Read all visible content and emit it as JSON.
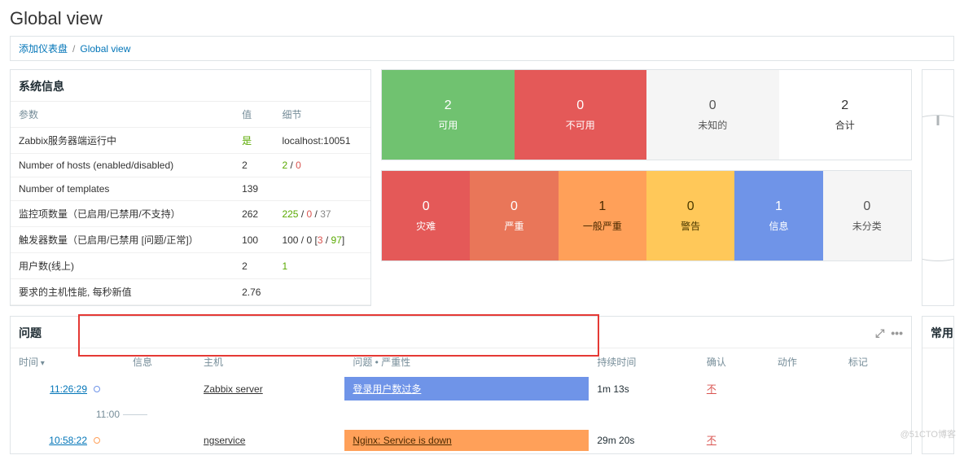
{
  "page": {
    "title": "Global view"
  },
  "breadcrumb": {
    "add": "添加仪表盘",
    "current": "Global view"
  },
  "sysinfo": {
    "title": "系统信息",
    "cols": {
      "param": "参数",
      "value": "值",
      "detail": "细节"
    },
    "rows": [
      {
        "param": "Zabbix服务器端运行中",
        "value_html": "yes",
        "value": "是",
        "detail": "localhost:10051"
      },
      {
        "param": "Number of hosts (enabled/disabled)",
        "value": "2",
        "detail_parts": [
          "2",
          " / ",
          "0"
        ],
        "detail_classes": [
          "green",
          "",
          "red"
        ]
      },
      {
        "param": "Number of templates",
        "value": "139",
        "detail": ""
      },
      {
        "param": "监控项数量（已启用/已禁用/不支持）",
        "value": "262",
        "detail_parts": [
          "225",
          " / ",
          "0",
          " / ",
          "37"
        ],
        "detail_classes": [
          "green",
          "",
          "red",
          "",
          "grey"
        ]
      },
      {
        "param": "触发器数量（已启用/已禁用 [问题/正常]）",
        "value": "100",
        "detail_parts": [
          "100 / 0 [",
          "3",
          " / ",
          "97",
          "]"
        ],
        "detail_classes": [
          "",
          "red",
          "",
          "green",
          ""
        ]
      },
      {
        "param": "用户数(线上)",
        "value": "2",
        "detail_parts": [
          "1"
        ],
        "detail_classes": [
          "green"
        ]
      },
      {
        "param": "要求的主机性能, 每秒新值",
        "value": "2.76",
        "detail": ""
      }
    ]
  },
  "hosts_status": [
    {
      "num": "2",
      "label": "可用",
      "cls": "c-avail"
    },
    {
      "num": "0",
      "label": "不可用",
      "cls": "c-unavail"
    },
    {
      "num": "0",
      "label": "未知的",
      "cls": "c-unknown"
    },
    {
      "num": "2",
      "label": "合计",
      "cls": "c-total"
    }
  ],
  "severity_status": [
    {
      "num": "0",
      "label": "灾难",
      "cls": "c-disaster"
    },
    {
      "num": "0",
      "label": "严重",
      "cls": "c-high"
    },
    {
      "num": "1",
      "label": "一般严重",
      "cls": "c-average"
    },
    {
      "num": "0",
      "label": "警告",
      "cls": "c-warning"
    },
    {
      "num": "1",
      "label": "信息",
      "cls": "c-info"
    },
    {
      "num": "0",
      "label": "未分类",
      "cls": "c-na"
    }
  ],
  "problems": {
    "title": "问题",
    "cols": {
      "time": "时间",
      "info": "信息",
      "host": "主机",
      "problem": "问题 • 严重性",
      "duration": "持续时间",
      "ack": "确认",
      "actions": "动作",
      "tags": "标记"
    },
    "time_marker": "11:00",
    "rows": [
      {
        "time": "11:26:29",
        "host": "Zabbix server",
        "sev_cls": "sev-info",
        "problem": "登录用户数过多",
        "duration": "1m 13s",
        "ack": "不"
      },
      {
        "time": "10:58:22",
        "host": "ngservice",
        "sev_cls": "sev-average",
        "problem": "Nginx: Service is down",
        "duration": "29m 20s",
        "ack": "不"
      }
    ]
  },
  "side": {
    "title": "常用的"
  },
  "watermark": "@51CTO博客"
}
